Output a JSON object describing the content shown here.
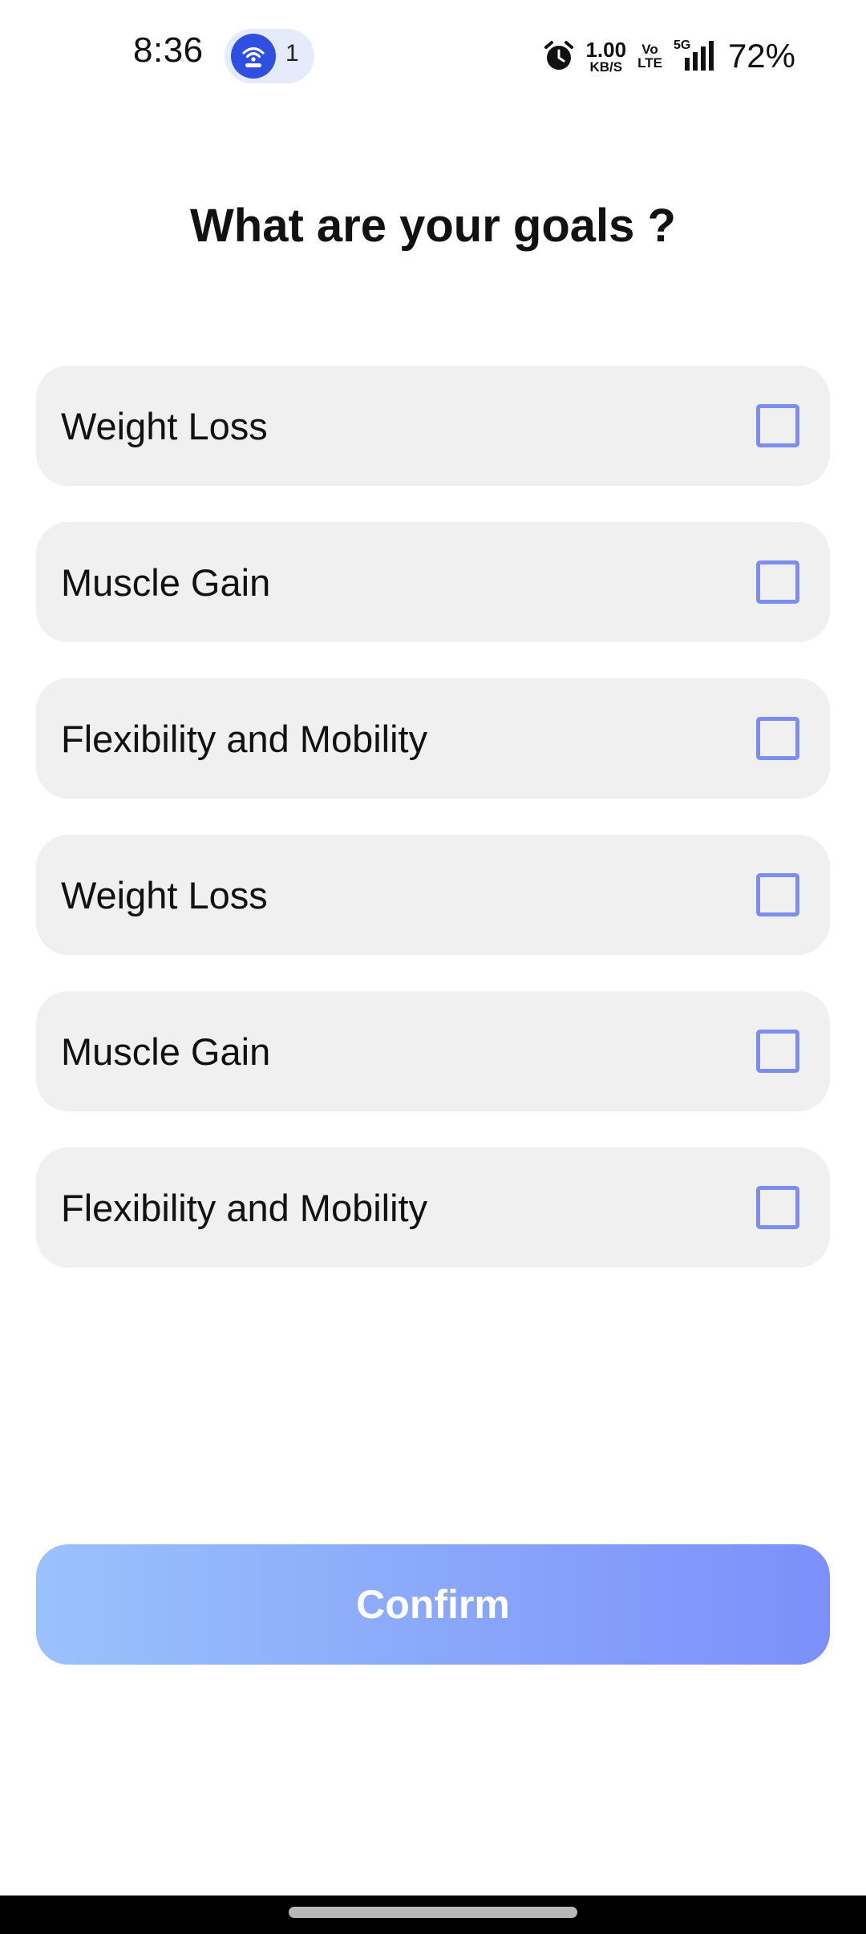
{
  "status_bar": {
    "time": "8:36",
    "hotspot_count": "1",
    "net_speed_value": "1.00",
    "net_speed_unit": "KB/S",
    "volte_top": "Vo",
    "volte_bottom": "LTE",
    "network_type": "5G",
    "battery": "72%",
    "icons": [
      "hotspot-icon",
      "alarm-icon",
      "signal-icon"
    ]
  },
  "page": {
    "title": "What are your goals ?"
  },
  "goals": [
    {
      "label": "Weight Loss",
      "checked": false
    },
    {
      "label": "Muscle Gain",
      "checked": false
    },
    {
      "label": "Flexibility and Mobility",
      "checked": false
    },
    {
      "label": "Weight Loss",
      "checked": false
    },
    {
      "label": "Muscle Gain",
      "checked": false
    },
    {
      "label": "Flexibility and Mobility",
      "checked": false
    }
  ],
  "confirm": {
    "label": "Confirm"
  },
  "colors": {
    "accent": "#7c8df0",
    "button_gradient_start": "#9ac2fc",
    "button_gradient_end": "#7b90fb",
    "card_background": "#f0f0f0",
    "hotspot_blue": "#2f4fe0"
  }
}
